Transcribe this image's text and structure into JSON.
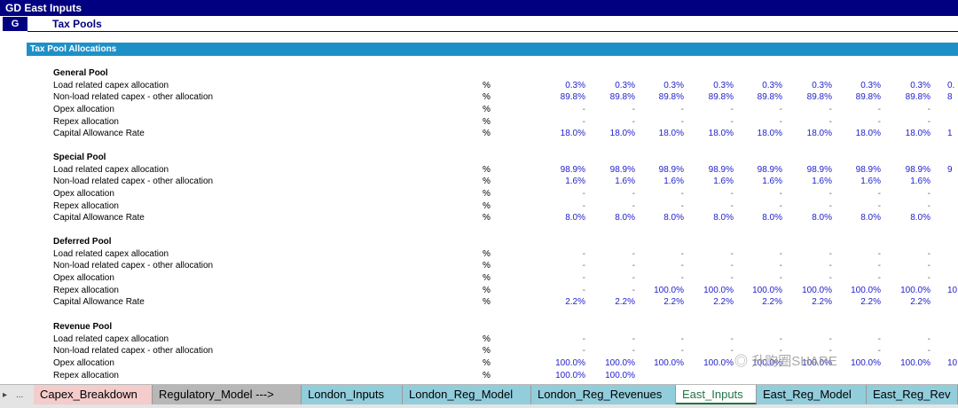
{
  "title": "GD East Inputs",
  "section": {
    "letter": "G",
    "title": "Tax Pools"
  },
  "subheader": "Tax Pool Allocations",
  "pools": [
    {
      "name": "General Pool",
      "rows": [
        {
          "label": "Load related capex allocation",
          "unit": "%",
          "values": [
            "0.3%",
            "0.3%",
            "0.3%",
            "0.3%",
            "0.3%",
            "0.3%",
            "0.3%",
            "0.3%"
          ]
        },
        {
          "label": "Non-load related capex - other allocation",
          "unit": "%",
          "values": [
            "89.8%",
            "89.8%",
            "89.8%",
            "89.8%",
            "89.8%",
            "89.8%",
            "89.8%",
            "89.8%"
          ]
        },
        {
          "label": "Opex allocation",
          "unit": "%",
          "values": [
            "-",
            "-",
            "-",
            "-",
            "-",
            "-",
            "-",
            "-"
          ]
        },
        {
          "label": "Repex allocation",
          "unit": "%",
          "values": [
            "-",
            "-",
            "-",
            "-",
            "-",
            "-",
            "-",
            "-"
          ]
        },
        {
          "label": "Capital Allowance Rate",
          "unit": "%",
          "values": [
            "18.0%",
            "18.0%",
            "18.0%",
            "18.0%",
            "18.0%",
            "18.0%",
            "18.0%",
            "18.0%"
          ]
        }
      ]
    },
    {
      "name": "Special Pool",
      "rows": [
        {
          "label": "Load related capex allocation",
          "unit": "%",
          "values": [
            "98.9%",
            "98.9%",
            "98.9%",
            "98.9%",
            "98.9%",
            "98.9%",
            "98.9%",
            "98.9%"
          ]
        },
        {
          "label": "Non-load related capex - other allocation",
          "unit": "%",
          "values": [
            "1.6%",
            "1.6%",
            "1.6%",
            "1.6%",
            "1.6%",
            "1.6%",
            "1.6%",
            "1.6%"
          ]
        },
        {
          "label": "Opex allocation",
          "unit": "%",
          "values": [
            "-",
            "-",
            "-",
            "-",
            "-",
            "-",
            "-",
            "-"
          ]
        },
        {
          "label": "Repex allocation",
          "unit": "%",
          "values": [
            "-",
            "-",
            "-",
            "-",
            "-",
            "-",
            "-",
            "-"
          ]
        },
        {
          "label": "Capital Allowance Rate",
          "unit": "%",
          "values": [
            "8.0%",
            "8.0%",
            "8.0%",
            "8.0%",
            "8.0%",
            "8.0%",
            "8.0%",
            "8.0%"
          ]
        }
      ]
    },
    {
      "name": "Deferred Pool",
      "rows": [
        {
          "label": "Load related capex allocation",
          "unit": "%",
          "values": [
            "-",
            "-",
            "-",
            "-",
            "-",
            "-",
            "-",
            "-"
          ]
        },
        {
          "label": "Non-load related capex - other allocation",
          "unit": "%",
          "values": [
            "-",
            "-",
            "-",
            "-",
            "-",
            "-",
            "-",
            "-"
          ]
        },
        {
          "label": "Opex allocation",
          "unit": "%",
          "values": [
            "-",
            "-",
            "-",
            "-",
            "-",
            "-",
            "-",
            "-"
          ]
        },
        {
          "label": "Repex allocation",
          "unit": "%",
          "values": [
            "-",
            "-",
            "100.0%",
            "100.0%",
            "100.0%",
            "100.0%",
            "100.0%",
            "100.0%"
          ]
        },
        {
          "label": "Capital Allowance Rate",
          "unit": "%",
          "values": [
            "2.2%",
            "2.2%",
            "2.2%",
            "2.2%",
            "2.2%",
            "2.2%",
            "2.2%",
            "2.2%"
          ]
        }
      ]
    },
    {
      "name": "Revenue Pool",
      "rows": [
        {
          "label": "Load related capex allocation",
          "unit": "%",
          "values": [
            "-",
            "-",
            "-",
            "-",
            "-",
            "-",
            "-",
            "-"
          ]
        },
        {
          "label": "Non-load related capex - other allocation",
          "unit": "%",
          "values": [
            "-",
            "-",
            "-",
            "-",
            "-",
            "-",
            "-",
            "-"
          ]
        },
        {
          "label": "Opex allocation",
          "unit": "%",
          "values": [
            "100.0%",
            "100.0%",
            "100.0%",
            "100.0%",
            "100.0%",
            "100.0%",
            "100.0%",
            "100.0%"
          ]
        },
        {
          "label": "Repex allocation",
          "unit": "%",
          "values": [
            "100.0%",
            "100.0%",
            "",
            "",
            "",
            "",
            "",
            ""
          ]
        }
      ]
    }
  ],
  "partial_column": {
    "pool0": [
      "0.",
      "8",
      "",
      "",
      "1"
    ],
    "pool1": [
      "9",
      "",
      "",
      "",
      ""
    ],
    "pool2": [
      "",
      "",
      "",
      "10",
      ""
    ],
    "pool3": [
      "",
      "",
      "10",
      ""
    ]
  },
  "sheet_tabs": [
    {
      "label": "Capex_Breakdown",
      "color": "#f4cccc",
      "active": false
    },
    {
      "label": "Regulatory_Model --->",
      "color": "#b7b7b7",
      "active": false
    },
    {
      "label": "London_Inputs",
      "color": "#92cddc",
      "active": false
    },
    {
      "label": "London_Reg_Model",
      "color": "#92cddc",
      "active": false
    },
    {
      "label": "London_Reg_Revenues",
      "color": "#92cddc",
      "active": false
    },
    {
      "label": "East_Inputs",
      "color": "#ffffff",
      "active": true
    },
    {
      "label": "East_Reg_Model",
      "color": "#92cddc",
      "active": false
    },
    {
      "label": "East_Reg_Rev",
      "color": "#92cddc",
      "active": false
    }
  ],
  "tab_nav": {
    "prev": "▸",
    "more": "..."
  },
  "watermark": "升购圈SHARE",
  "icons": {
    "watermark_logo": "wechat-logo-icon"
  }
}
